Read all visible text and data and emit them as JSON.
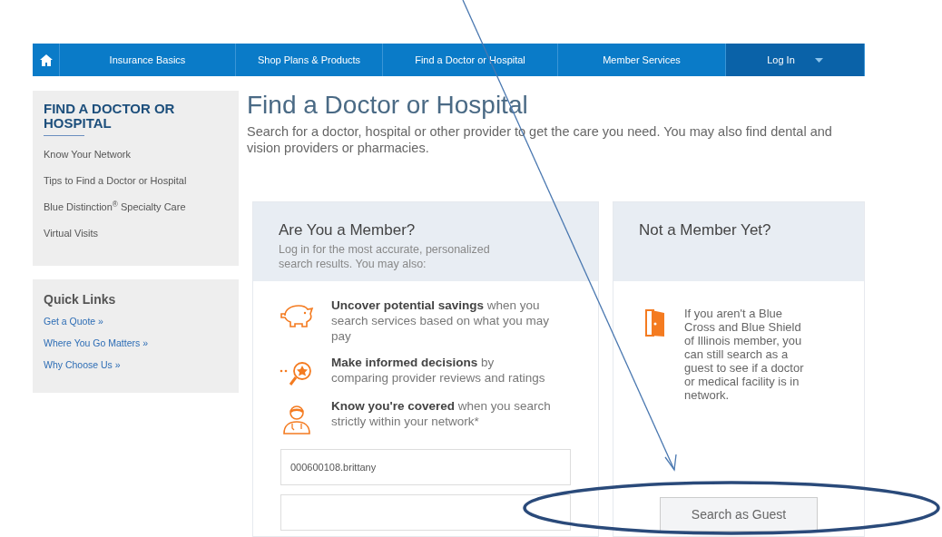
{
  "nav": {
    "items": [
      {
        "kind": "home",
        "selected": false
      },
      {
        "kind": "link",
        "label": "Insurance Basics",
        "selected": false
      },
      {
        "kind": "link",
        "label": "Shop Plans & Products",
        "selected": false
      },
      {
        "kind": "link",
        "label": "Find a Doctor or Hospital",
        "selected": false
      },
      {
        "kind": "link",
        "label": "Member Services",
        "selected": false
      },
      {
        "kind": "login",
        "label": "Log In",
        "selected": false
      }
    ]
  },
  "sidebar": {
    "heading": "FIND A DOCTOR OR HOSPITAL",
    "items": [
      "Know Your Network",
      "Tips to Find a Doctor or Hospital",
      "Blue Distinction$^{®}$ Specialty Care",
      "Virtual Visits"
    ],
    "quick_links": {
      "heading": "Quick Links",
      "items": [
        "Get a Quote »",
        "Where You Go Matters »",
        "Why Choose Us »"
      ]
    }
  },
  "page": {
    "title": "Find a Doctor or Hospital",
    "intro": "Search for a doctor, hospital or other provider to get the care you need. You may also find dental and vision providers or pharmacies."
  },
  "member_card": {
    "title": "Are You a Member?",
    "subtitle": "Log in for the most accurate, personalized search results. You may also:",
    "benefits": [
      {
        "kind": "piggy",
        "text": "**Uncover potential savings** when you search services based on what you may pay"
      },
      {
        "kind": "rating",
        "text": "**Make informed decisions** by comparing provider reviews and ratings"
      },
      {
        "kind": "person",
        "text": "**Know you're covered** when you search strictly within your network*"
      }
    ],
    "username": "000600108.brittany"
  },
  "guest_card": {
    "title": "Not a Member Yet?",
    "text": "If you aren't a Blue Cross and Blue Shield of Illinois member, you can still search as a guest to see if a doctor or medical facility is in network.",
    "button": "Search as Guest"
  }
}
